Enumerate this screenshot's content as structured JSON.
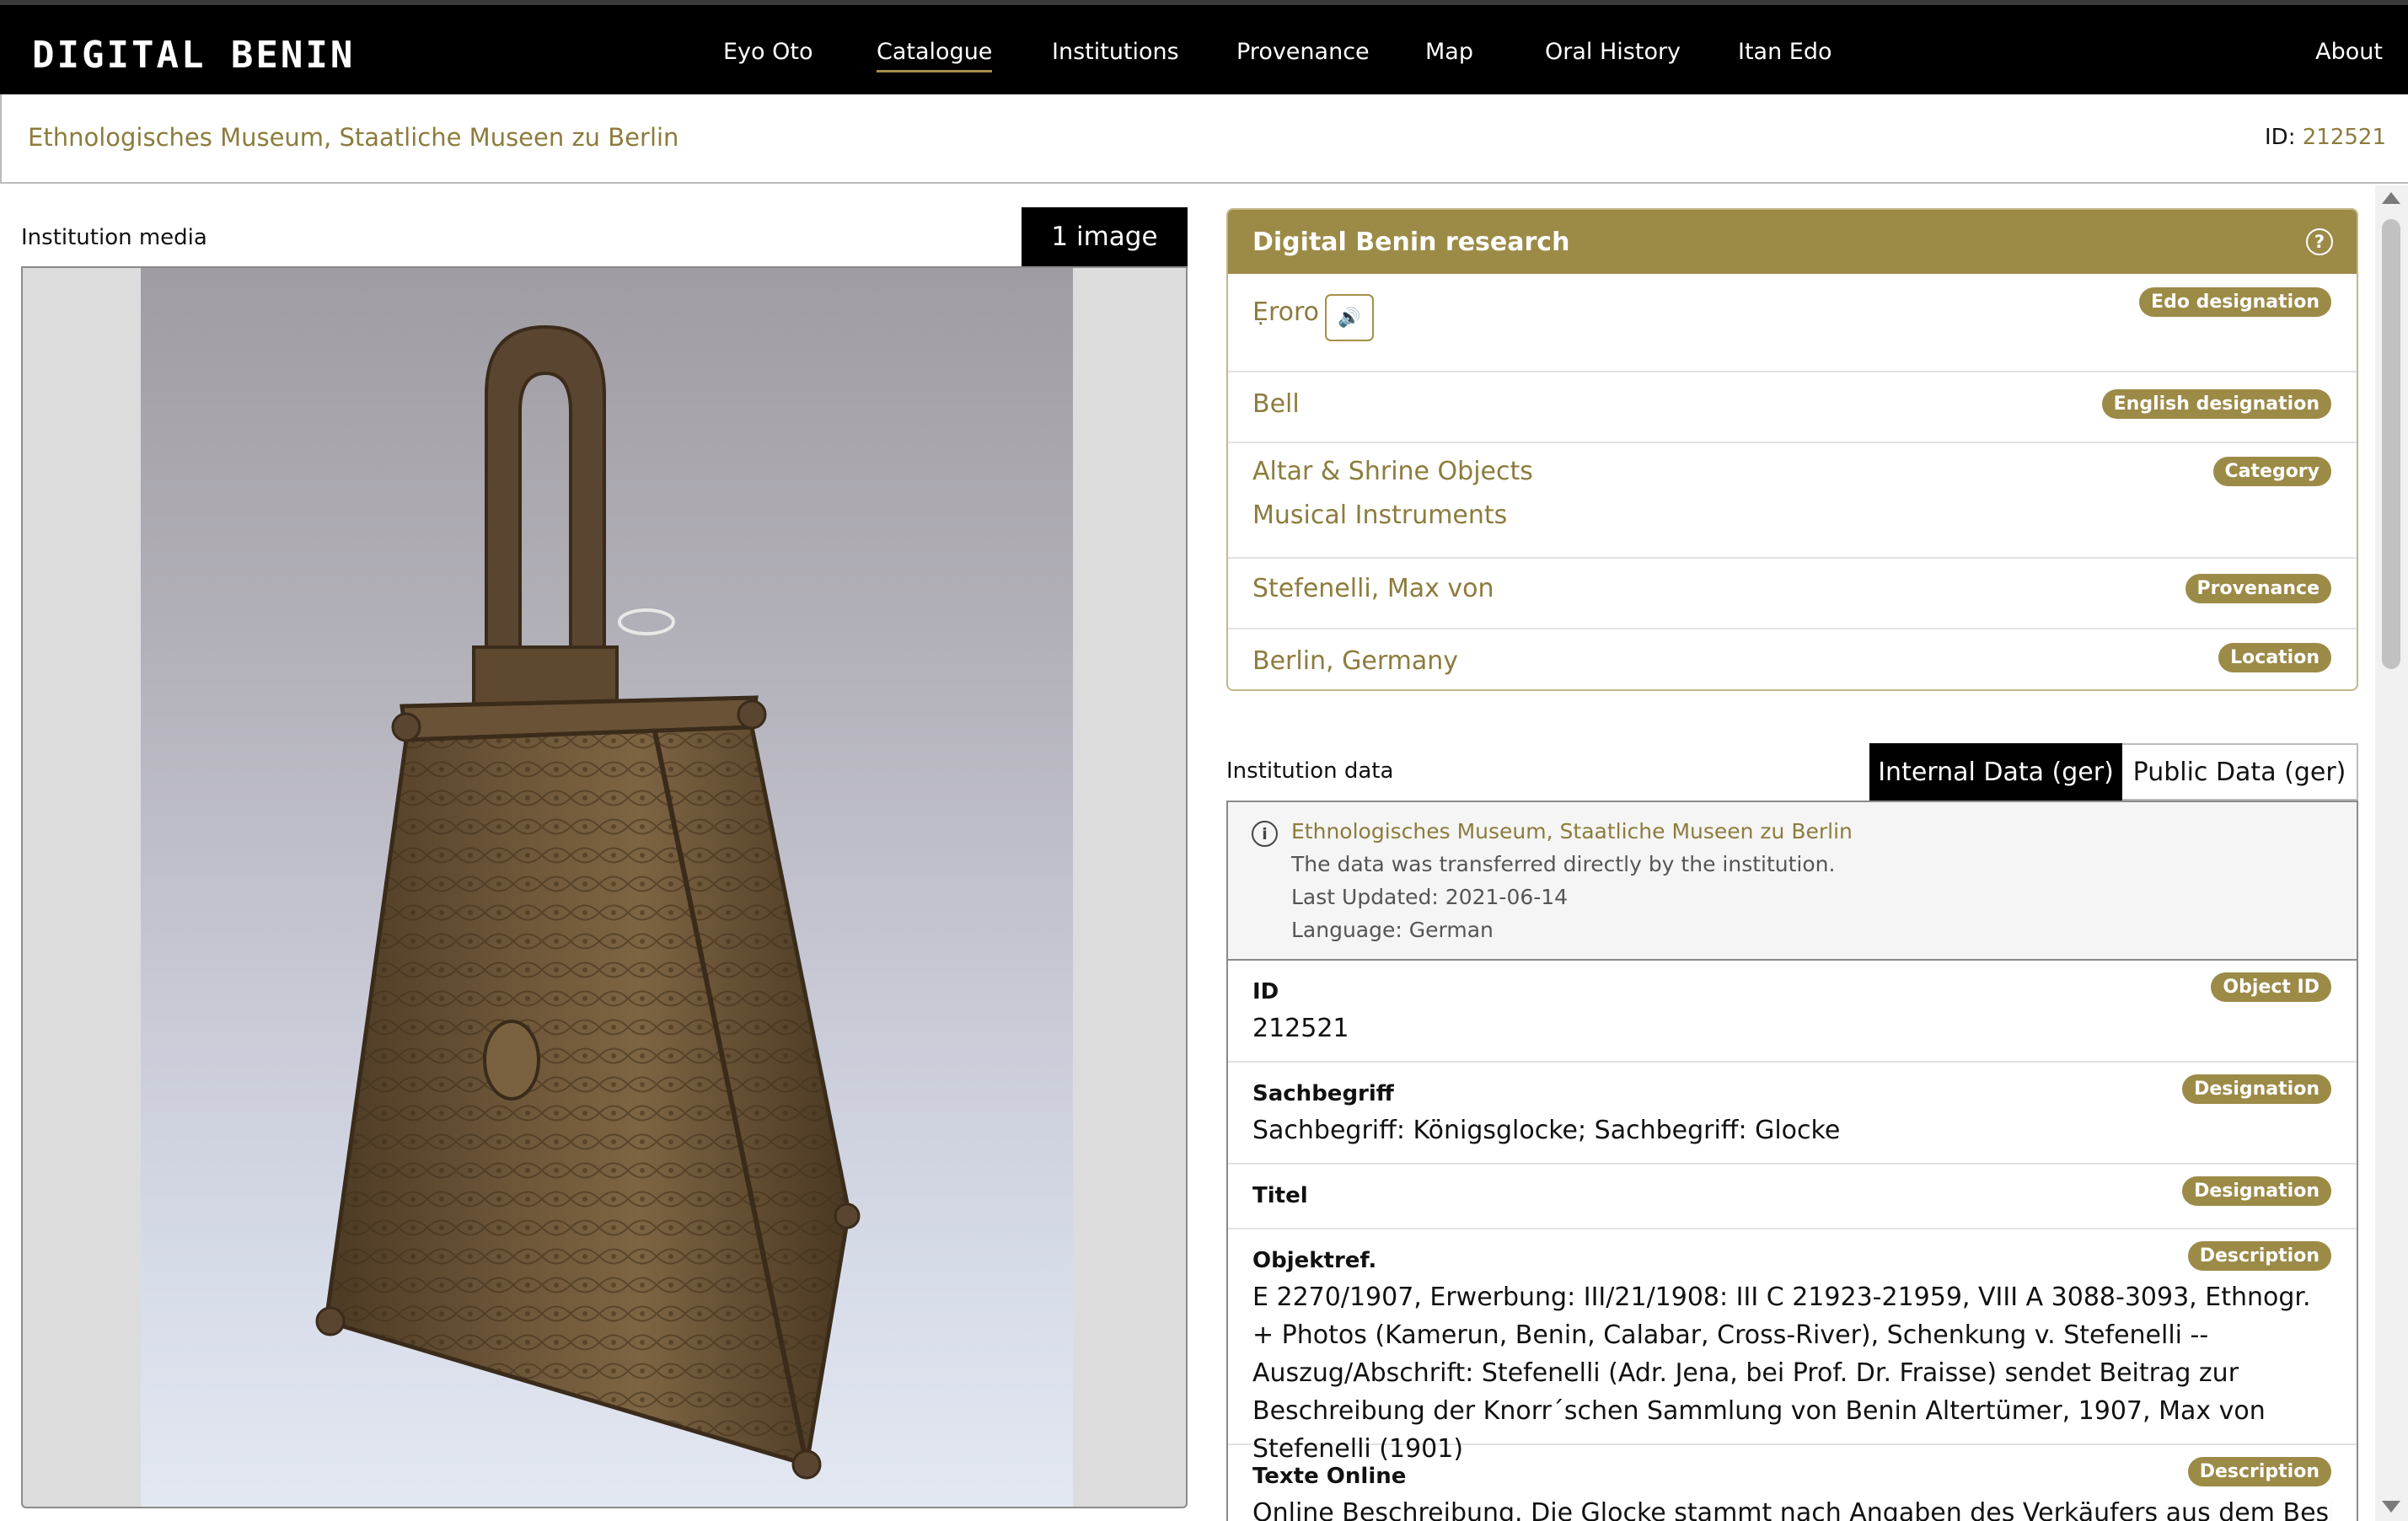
{
  "header": {
    "logo_text": "DIGITAL BENIN",
    "nav": [
      "Eyo Oto",
      "Catalogue",
      "Institutions",
      "Provenance",
      "Map",
      "Oral History",
      "Itan Edo"
    ],
    "about": "About",
    "active": "Catalogue"
  },
  "breadcrumb": {
    "institution": "Ethnologisches Museum, Staatliche Museen zu Berlin",
    "id_label": "ID:",
    "id_value": "212521"
  },
  "media": {
    "title": "Institution media",
    "image_count": "1 image"
  },
  "research": {
    "title": "Digital Benin research",
    "help_icon": "?",
    "rows": [
      {
        "value": "Ẹroro",
        "badge": "Edo designation"
      },
      {
        "value": "Bell",
        "badge": "English designation"
      },
      {
        "values": [
          "Altar & Shrine Objects",
          "Musical Instruments"
        ],
        "badge": "Category"
      },
      {
        "value": "Stefenelli, Max von",
        "badge": "Provenance"
      },
      {
        "value": "Berlin, Germany",
        "badge": "Location"
      }
    ]
  },
  "institution_data": {
    "title": "Institution data",
    "tabs": [
      "Internal Data (ger)",
      "Public Data (ger)"
    ],
    "info": {
      "museum": "Ethnologisches Museum, Staatliche Museen zu Berlin",
      "transfer": "The data was transferred directly by the institution.",
      "updated": "Last Updated: 2021-06-14",
      "language": "Language: German"
    },
    "rows": [
      {
        "label": "ID",
        "badge": "Object ID",
        "value": "212521"
      },
      {
        "label": "Sachbegriff",
        "badge": "Designation",
        "value": "Sachbegriff: Königsglocke; Sachbegriff: Glocke"
      },
      {
        "label": "Titel",
        "badge": "Designation",
        "value": ""
      },
      {
        "label": "Objektref.",
        "badge": "Description",
        "value": "E 2270/1907, Erwerbung: III/21/1908: III C 21923-21959, VIII A 3088-3093, Ethnogr. + Photos (Kamerun, Benin, Calabar, Cross-River), Schenkung v. Stefenelli -- Auszug/Abschrift: Stefenelli (Adr. Jena, bei Prof. Dr. Fraisse) sendet Beitrag zur Beschreibung der Knorr´schen Sammlung von Benin Altertümer, 1907, Max von Stefenelli (1901)"
      },
      {
        "label": "Texte Online",
        "badge": "Description",
        "value": "Online Beschreibung. Die Glocke stammt nach Angaben des Verkäufers aus dem Besitz des"
      }
    ]
  },
  "colors": {
    "accent": "#9c8a47",
    "accent_text": "#8c7c3d",
    "topbar": "#000000"
  }
}
